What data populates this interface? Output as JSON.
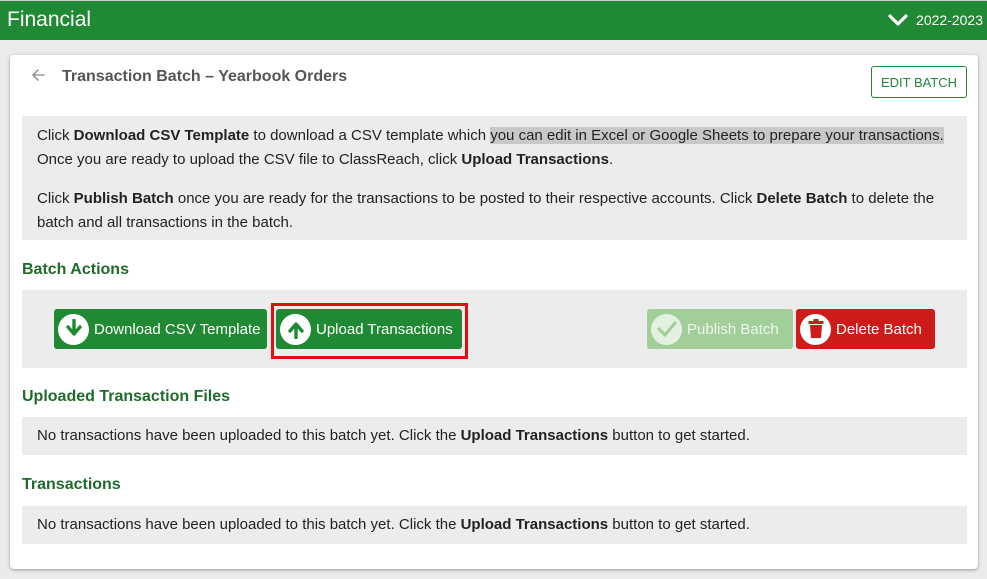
{
  "header": {
    "title": "Financial",
    "year": "2022-2023"
  },
  "page": {
    "title": "Transaction Batch – Yearbook Orders",
    "edit_label": "EDIT BATCH"
  },
  "info": {
    "p1_a": "Click ",
    "p1_b": "Download CSV Template",
    "p1_c": " to download a CSV template which ",
    "p1_hl": "you can edit in Excel or Google Sheets to prepare your transactions.",
    "p1_d": " Once you are ready to upload the CSV file to ClassReach, click ",
    "p1_e": "Upload Transactions",
    "p1_f": ".",
    "p2_a": "Click ",
    "p2_b": "Publish Batch",
    "p2_c": " once you are ready for the transactions to be posted to their respective accounts. Click ",
    "p2_d": "Delete Batch",
    "p2_e": " to delete the batch and all transactions in the batch."
  },
  "batch_actions": {
    "label": "Batch Actions",
    "download_label": "Download CSV Template",
    "upload_label": "Upload Transactions",
    "publish_label": "Publish Batch",
    "delete_label": "Delete Batch"
  },
  "uploaded_files": {
    "label": "Uploaded Transaction Files",
    "msg_a": "No transactions have been uploaded to this batch yet. Click the ",
    "msg_b": "Upload Transactions",
    "msg_c": " button to get started."
  },
  "transactions": {
    "label": "Transactions",
    "msg_a": "No transactions have been uploaded to this batch yet. Click the ",
    "msg_b": "Upload Transactions",
    "msg_c": " button to get started."
  },
  "colors": {
    "primary": "#1f8a33",
    "danger": "#cf1a1a",
    "disabled": "#a2cf99",
    "highlight": "#e01010"
  },
  "icons": {
    "year_toggle": "chevron-down-icon",
    "back": "arrow-left-icon",
    "download": "arrow-down-circle-icon",
    "upload": "arrow-up-circle-icon",
    "publish": "check-circle-icon",
    "delete": "trash-icon"
  }
}
